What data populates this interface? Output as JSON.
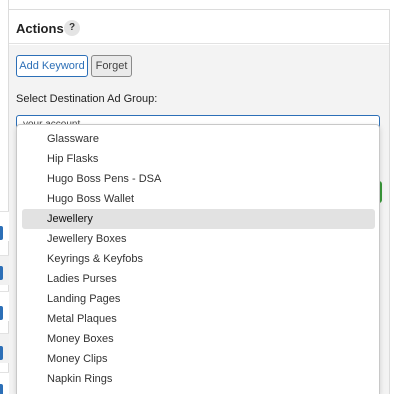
{
  "panel": {
    "title": "Actions",
    "help_icon": "?"
  },
  "buttons": {
    "add_keyword": "Add Keyword",
    "forget": "Forget"
  },
  "destination": {
    "label": "Select Destination Ad Group:",
    "selected_value": "your account"
  },
  "dropdown": {
    "options": [
      "Glassware",
      "Hip Flasks",
      "Hugo Boss Pens - DSA",
      "Hugo Boss Wallet",
      "Jewellery",
      "Jewellery Boxes",
      "Keyrings & Keyfobs",
      "Ladies Purses",
      "Landing Pages",
      "Metal Plaques",
      "Money Boxes",
      "Money Clips",
      "Napkin Rings"
    ],
    "highlighted_option": "Jewellery"
  },
  "colors": {
    "accent": "#2c6fb7",
    "highlight": "#e2e2e2",
    "green": "#3a9a3a"
  },
  "icons": [
    "help-icon",
    "chevron-down-icon"
  ]
}
